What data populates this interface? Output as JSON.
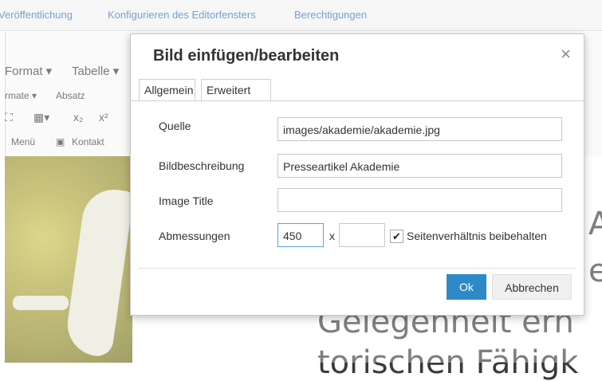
{
  "topnav": {
    "items": [
      "Veröffentlichung",
      "Konfigurieren des Editorfensters",
      "Berechtigungen"
    ]
  },
  "menubar": {
    "items": [
      "Format ▾",
      "Tabelle ▾"
    ]
  },
  "toolbar": {
    "formats": "rmate ▾",
    "paragraph": "Absatz",
    "menu_label": "Menü",
    "contact_label": "Kontakt"
  },
  "editor_text": {
    "line1": "A",
    "line2": "e",
    "line3": "Gelegenheit  erh",
    "line4": "torischen Fähigk"
  },
  "dialog": {
    "title": "Bild einfügen/bearbeiten",
    "close": "×",
    "tabs": [
      "Allgemein",
      "Erweitert"
    ],
    "fields": {
      "source": {
        "label": "Quelle",
        "value": "images/akademie/akademie.jpg"
      },
      "description": {
        "label": "Bildbeschreibung",
        "value": "Presseartikel Akademie"
      },
      "title": {
        "label": "Image Title",
        "value": ""
      },
      "dimensions": {
        "label": "Abmessungen",
        "width": "450",
        "separator": "x",
        "height": "",
        "keep_ratio_label": "Seitenverhältnis beibehalten",
        "keep_ratio_checked": true
      }
    },
    "buttons": {
      "ok": "Ok",
      "cancel": "Abbrechen"
    }
  },
  "colors": {
    "accent": "#2d8ac7",
    "link": "#2a6ebb"
  }
}
